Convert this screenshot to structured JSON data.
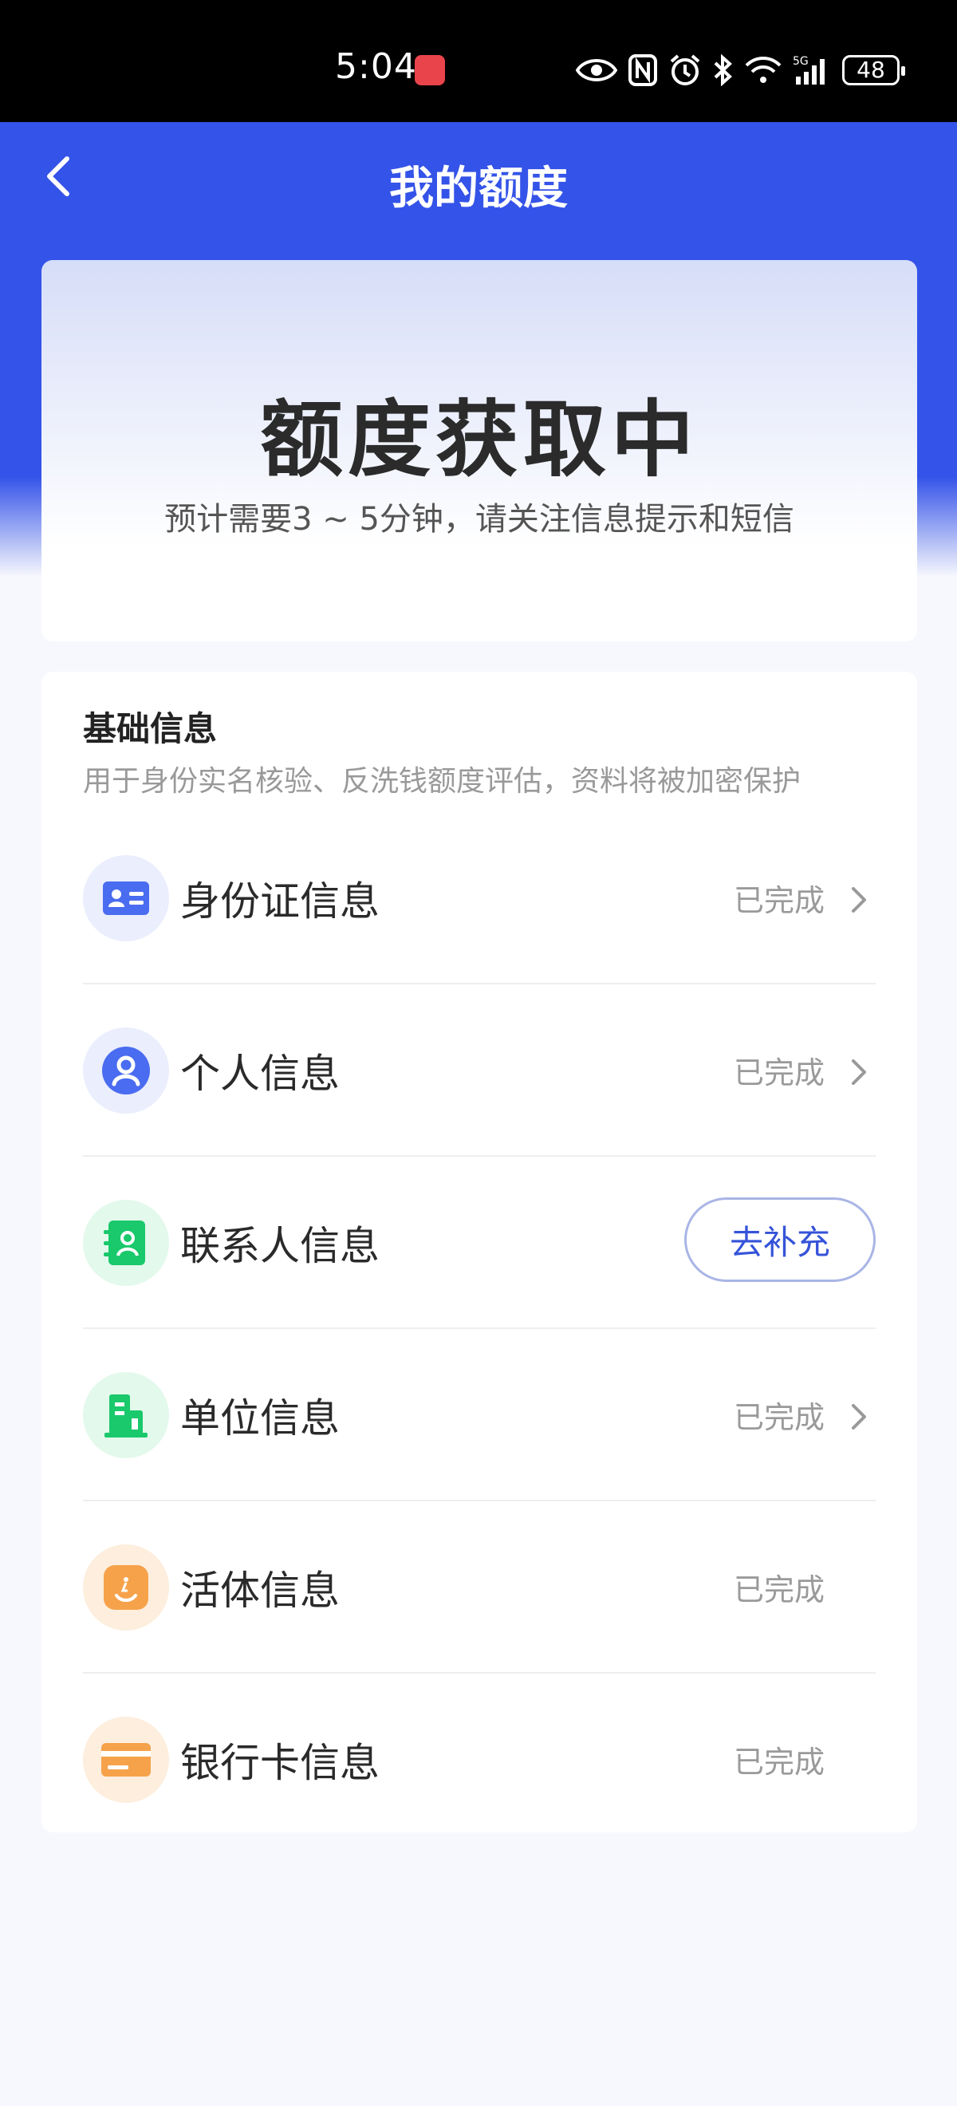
{
  "status_bar": {
    "time": "5:04",
    "battery": "48",
    "network": "5G"
  },
  "header": {
    "title": "我的额度"
  },
  "quota": {
    "status": "额度获取中",
    "hint": "预计需要3 ~ 5分钟，请关注信息提示和短信"
  },
  "basic_info": {
    "title": "基础信息",
    "description": "用于身份实名核验、反洗钱额度评估，资料将被加密保护",
    "items": [
      {
        "label": "身份证信息",
        "status": "已完成",
        "icon": "id-card-icon"
      },
      {
        "label": "个人信息",
        "status": "已完成",
        "icon": "person-icon"
      },
      {
        "label": "联系人信息",
        "action": "去补充",
        "icon": "contacts-icon"
      },
      {
        "label": "单位信息",
        "status": "已完成",
        "icon": "building-icon"
      },
      {
        "label": "活体信息",
        "status": "已完成",
        "icon": "face-icon"
      },
      {
        "label": "银行卡信息",
        "status": "已完成",
        "icon": "bank-card-icon"
      }
    ]
  },
  "colors": {
    "primary": "#3453e8",
    "id_icon": "#4a6cf0",
    "contacts_icon": "#19c96b",
    "face_icon": "#f6a24b"
  }
}
